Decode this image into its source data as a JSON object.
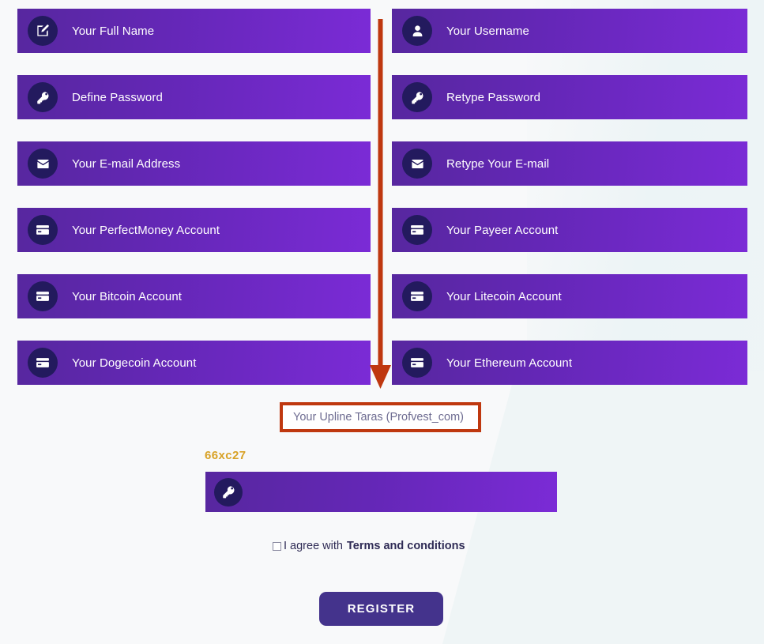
{
  "theme": {
    "background": "#f8f9fa",
    "field_gradient_start": "#57279f",
    "field_gradient_end": "#7b2bd6",
    "icon_badge": "#231a5e",
    "annotation_red": "#bf380f",
    "captcha_gold": "#d8a227",
    "button_purple": "#44338c"
  },
  "form": {
    "fields": [
      {
        "label": "Your Full Name",
        "icon": "edit-pencil-icon",
        "column": "left",
        "row": 0,
        "value": ""
      },
      {
        "label": "Your Username",
        "icon": "user-icon",
        "column": "right",
        "row": 0,
        "value": ""
      },
      {
        "label": "Define Password",
        "icon": "key-icon",
        "column": "left",
        "row": 1,
        "value": ""
      },
      {
        "label": "Retype Password",
        "icon": "key-icon",
        "column": "right",
        "row": 1,
        "value": ""
      },
      {
        "label": "Your E-mail Address",
        "icon": "envelope-icon",
        "column": "left",
        "row": 2,
        "value": ""
      },
      {
        "label": "Retype Your E-mail",
        "icon": "envelope-icon",
        "column": "right",
        "row": 2,
        "value": ""
      },
      {
        "label": "Your PerfectMoney Account",
        "icon": "credit-card-icon",
        "column": "left",
        "row": 3,
        "value": ""
      },
      {
        "label": "Your Payeer Account",
        "icon": "credit-card-icon",
        "column": "right",
        "row": 3,
        "value": ""
      },
      {
        "label": "Your Bitcoin Account",
        "icon": "credit-card-icon",
        "column": "left",
        "row": 4,
        "value": ""
      },
      {
        "label": "Your Litecoin Account",
        "icon": "credit-card-icon",
        "column": "right",
        "row": 4,
        "value": ""
      },
      {
        "label": "Your Dogecoin Account",
        "icon": "credit-card-icon",
        "column": "left",
        "row": 5,
        "value": ""
      },
      {
        "label": "Your Ethereum Account",
        "icon": "credit-card-icon",
        "column": "right",
        "row": 5,
        "value": ""
      }
    ],
    "upline": {
      "text": "Your Upline Taras (Profvest_com)",
      "highlighted": true
    },
    "captcha": {
      "code": "66xc27",
      "input_value": "",
      "icon": "key-icon"
    },
    "terms": {
      "checked": false,
      "agree_text": "I agree with",
      "link_text": "Terms and conditions"
    },
    "submit": {
      "label": "REGISTER"
    }
  },
  "annotation": {
    "type": "down-arrow",
    "points_to": "Your Upline Taras (Profvest_com)"
  }
}
